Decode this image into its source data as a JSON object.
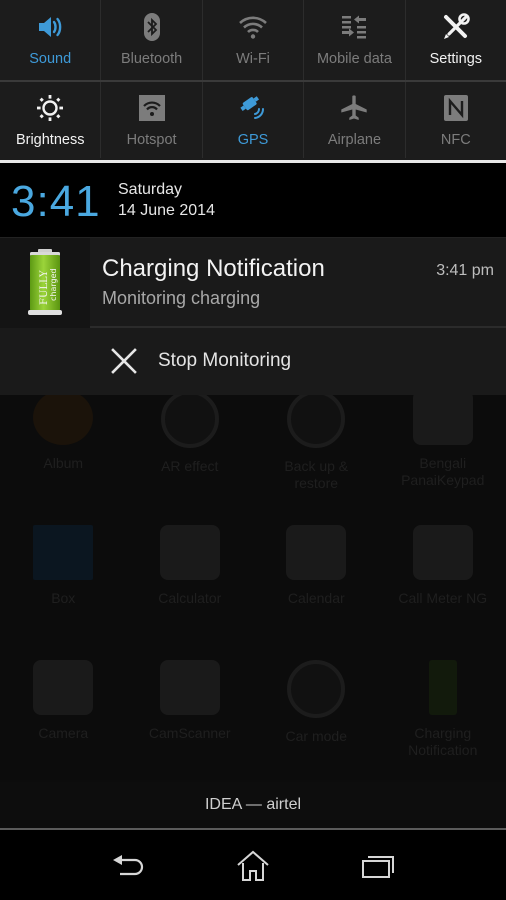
{
  "quick_settings": {
    "row1": [
      {
        "id": "sound",
        "label": "Sound",
        "icon": "volume-icon",
        "state": "on"
      },
      {
        "id": "bluetooth",
        "label": "Bluetooth",
        "icon": "bluetooth-icon",
        "state": "off"
      },
      {
        "id": "wifi",
        "label": "Wi-Fi",
        "icon": "wifi-icon",
        "state": "off"
      },
      {
        "id": "mobile-data",
        "label": "Mobile data",
        "icon": "mobile-data-icon",
        "state": "off"
      },
      {
        "id": "settings",
        "label": "Settings",
        "icon": "settings-icon",
        "state": "action"
      }
    ],
    "row2": [
      {
        "id": "brightness",
        "label": "Brightness",
        "icon": "brightness-icon",
        "state": "action"
      },
      {
        "id": "hotspot",
        "label": "Hotspot",
        "icon": "hotspot-icon",
        "state": "off"
      },
      {
        "id": "gps",
        "label": "GPS",
        "icon": "gps-icon",
        "state": "on"
      },
      {
        "id": "airplane",
        "label": "Airplane",
        "icon": "airplane-icon",
        "state": "off"
      },
      {
        "id": "nfc",
        "label": "NFC",
        "icon": "nfc-icon",
        "state": "off"
      }
    ],
    "colors": {
      "active": "#3e9ad8",
      "inactive": "#7c7c7c",
      "action": "#f2f2f2"
    }
  },
  "clock": {
    "time": "3:41",
    "day": "Saturday",
    "date": "14 June 2014"
  },
  "notification": {
    "app_icon": "battery-fully-charged-icon",
    "icon_text_1": "FULLY",
    "icon_text_2": "charged",
    "title": "Charging Notification",
    "text": "Monitoring charging",
    "time": "3:41 pm",
    "action": {
      "label": "Stop Monitoring",
      "icon": "close-icon"
    }
  },
  "background_apps": [
    {
      "label": "Album"
    },
    {
      "label": "AR effect"
    },
    {
      "label": "Back up & restore"
    },
    {
      "label": "Bengali PanaiKeypad"
    },
    {
      "label": "Box"
    },
    {
      "label": "Calculator"
    },
    {
      "label": "Calendar"
    },
    {
      "label": "Call Meter NG"
    },
    {
      "label": "Camera"
    },
    {
      "label": "CamScanner"
    },
    {
      "label": "Car mode"
    },
    {
      "label": "Charging Notification"
    }
  ],
  "carrier": {
    "label": "IDEA — airtel"
  },
  "navbar": {
    "back": "back-icon",
    "home": "home-icon",
    "recents": "recents-icon"
  }
}
